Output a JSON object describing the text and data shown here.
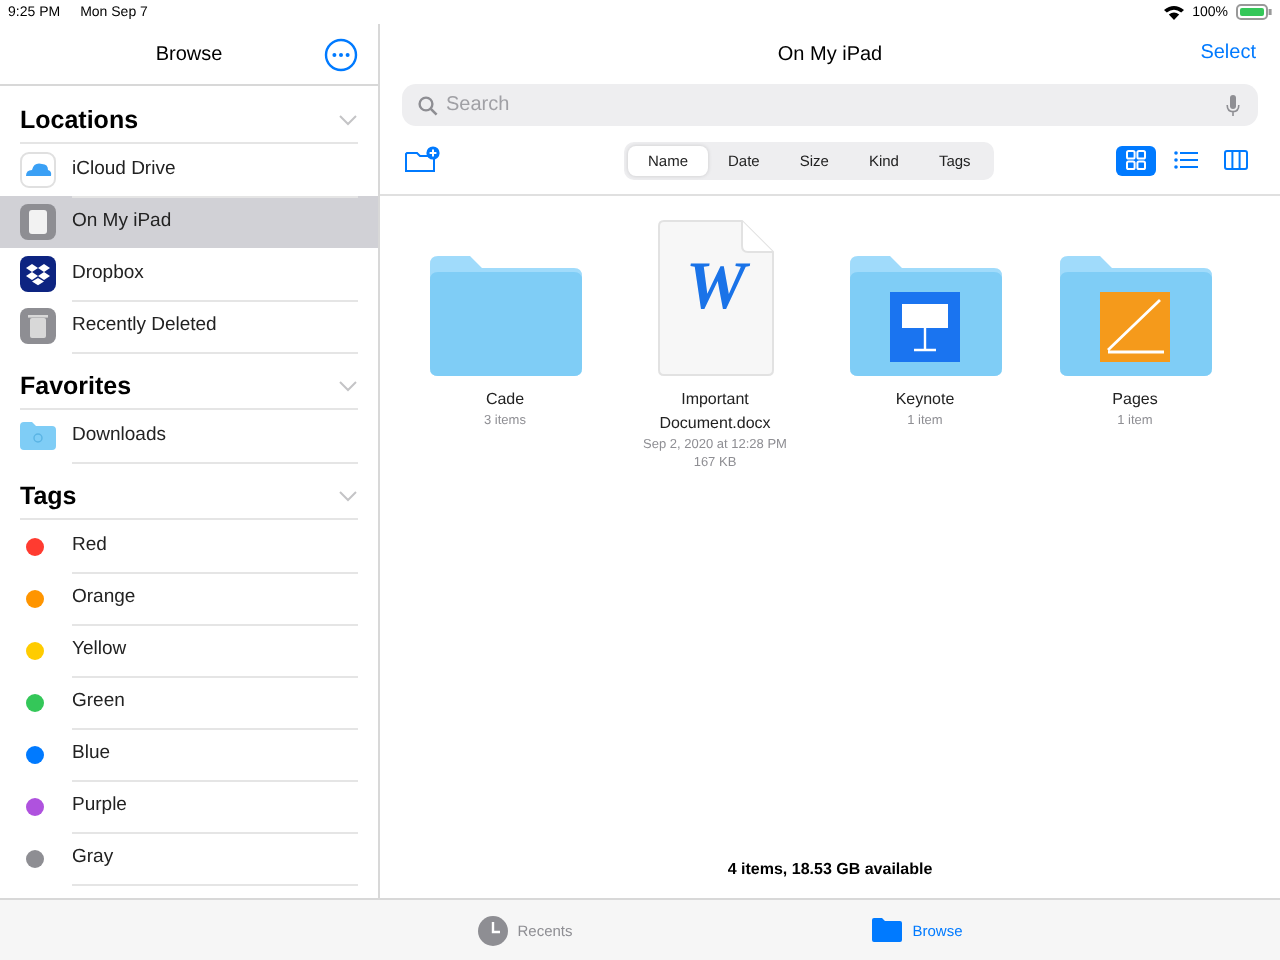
{
  "status_bar": {
    "time": "9:25 PM",
    "date": "Mon Sep 7",
    "battery": "100%"
  },
  "sidebar": {
    "title": "Browse",
    "sections": [
      {
        "title": "Locations",
        "expanded": true,
        "items": [
          {
            "label": "iCloud Drive",
            "kind": "cloud",
            "selected": false
          },
          {
            "label": "On My iPad",
            "kind": "ipad",
            "selected": true
          },
          {
            "label": "Dropbox",
            "kind": "dropbox",
            "selected": false
          },
          {
            "label": "Recently Deleted",
            "kind": "trash",
            "selected": false
          }
        ]
      },
      {
        "title": "Favorites",
        "expanded": true,
        "items": [
          {
            "label": "Downloads",
            "kind": "folder",
            "selected": false
          }
        ]
      },
      {
        "title": "Tags",
        "expanded": true,
        "items": [
          {
            "label": "Red",
            "kind": "tag",
            "color": "#ff3b30",
            "selected": false
          },
          {
            "label": "Orange",
            "kind": "tag",
            "color": "#ff9500",
            "selected": false
          },
          {
            "label": "Yellow",
            "kind": "tag",
            "color": "#ffcc00",
            "selected": false
          },
          {
            "label": "Green",
            "kind": "tag",
            "color": "#34c759",
            "selected": false
          },
          {
            "label": "Blue",
            "kind": "tag",
            "color": "#007aff",
            "selected": false
          },
          {
            "label": "Purple",
            "kind": "tag",
            "color": "#af52de",
            "selected": false
          },
          {
            "label": "Gray",
            "kind": "tag",
            "color": "#8e8e93",
            "selected": false
          }
        ]
      }
    ]
  },
  "main": {
    "title": "On My iPad",
    "select": "Select",
    "search": {
      "placeholder": "Search"
    },
    "sort_tabs": [
      {
        "label": "Name",
        "selected": true
      },
      {
        "label": "Date",
        "selected": false
      },
      {
        "label": "Size",
        "selected": false
      },
      {
        "label": "Kind",
        "selected": false
      },
      {
        "label": "Tags",
        "selected": false
      }
    ],
    "views": [
      {
        "kind": "grid",
        "selected": true
      },
      {
        "kind": "list",
        "selected": false
      },
      {
        "kind": "columns",
        "selected": false
      }
    ],
    "files": [
      {
        "kind": "folder",
        "name": "Cade",
        "details": [
          "3 items"
        ]
      },
      {
        "kind": "word",
        "logo_letter": "W",
        "name": "Important Document.docx",
        "details": [
          "Sep 2, 2020 at 12:28 PM",
          "167 KB"
        ]
      },
      {
        "kind": "keynote",
        "name": "Keynote",
        "details": [
          "1 item"
        ]
      },
      {
        "kind": "pages",
        "name": "Pages",
        "details": [
          "1 item"
        ]
      }
    ],
    "footer": "4 items, 18.53 GB available"
  },
  "tab_bar": [
    {
      "label": "Recents",
      "kind": "recents",
      "selected": false
    },
    {
      "label": "Browse",
      "kind": "browse",
      "selected": true
    }
  ]
}
